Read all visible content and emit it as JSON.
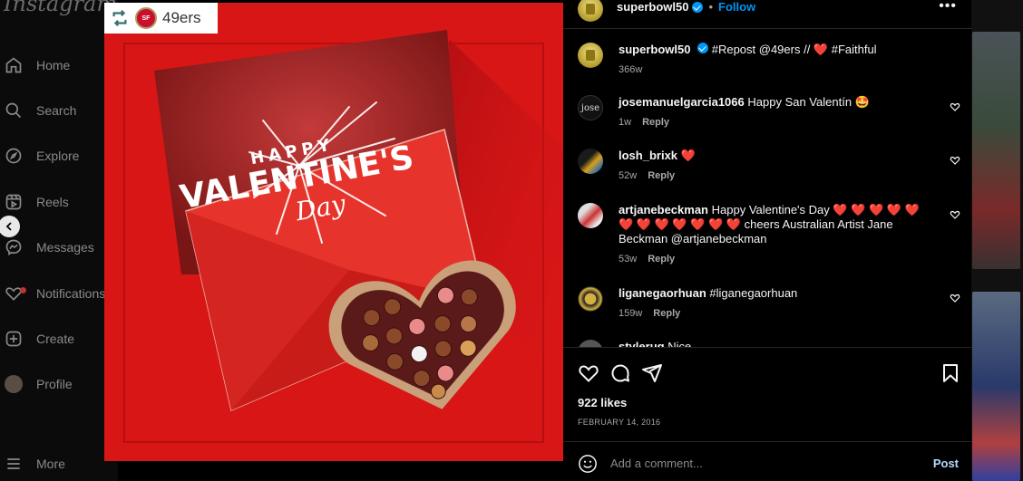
{
  "app": {
    "logo_text": "Instagram"
  },
  "nav": {
    "items": [
      {
        "label": "Home",
        "icon": "home-icon"
      },
      {
        "label": "Search",
        "icon": "search-icon"
      },
      {
        "label": "Explore",
        "icon": "compass-icon"
      },
      {
        "label": "Reels",
        "icon": "reels-icon"
      },
      {
        "label": "Messages",
        "icon": "messenger-icon"
      },
      {
        "label": "Notifications",
        "icon": "heart-icon"
      },
      {
        "label": "Create",
        "icon": "plus-square-icon"
      },
      {
        "label": "Profile",
        "icon": "avatar"
      }
    ],
    "more_label": "More"
  },
  "media": {
    "repost_account": "49ers",
    "badge_logo_text": "SF",
    "artwork_text": [
      "HAPPY",
      "VALENTINE'S",
      "Day"
    ]
  },
  "post": {
    "username": "superbowl50",
    "follow_label": "Follow",
    "separator": "•",
    "more_label": "•••",
    "caption": {
      "username": "superbowl50",
      "text": "#Repost @49ers // ❤️ #Faithful",
      "time": "366w"
    },
    "comments": [
      {
        "username": "josemanuelgarcia1066",
        "text": "Happy San Valentín 🤩",
        "time": "1w",
        "reply": "Reply",
        "avatar_text": "jose"
      },
      {
        "username": "losh_brixk",
        "text": "❤️",
        "time": "52w",
        "reply": "Reply"
      },
      {
        "username": "artjanebeckman",
        "text": "Happy Valentine's Day ❤️ ❤️ ❤️ ❤️ ❤️ ❤️ ❤️ ❤️ ❤️ ❤️ ❤️ ❤️ cheers Australian Artist Jane Beckman @artjanebeckman",
        "time": "53w",
        "reply": "Reply"
      },
      {
        "username": "liganegaorhuan",
        "text": "#liganegaorhuan",
        "time": "159w",
        "reply": "Reply"
      },
      {
        "username": "stylerug",
        "text": "Nice",
        "time": "",
        "reply": ""
      }
    ],
    "likes": "922 likes",
    "date": "FEBRUARY 14, 2016",
    "comment_placeholder": "Add a comment...",
    "post_label": "Post"
  },
  "colors": {
    "accent": "#0095f6",
    "post_disabled": "#b4dbfe",
    "media_red": "#d81616",
    "heart_red": "#e0245e"
  }
}
